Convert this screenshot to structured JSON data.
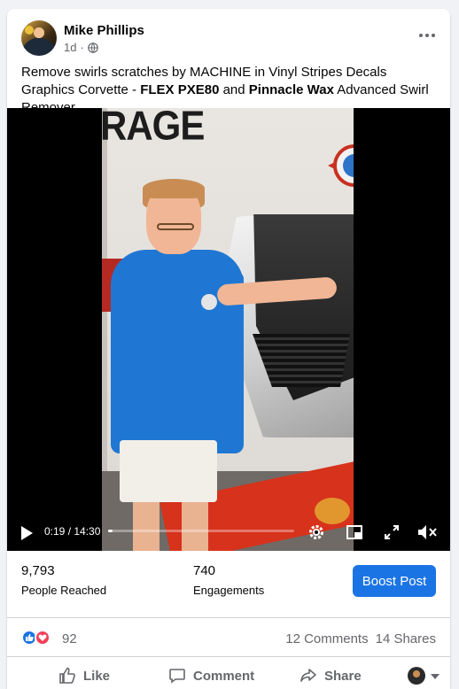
{
  "post": {
    "author": "Mike Phillips",
    "time": "1d",
    "time_sep": "·",
    "privacy_icon": "globe-icon",
    "text_parts": [
      {
        "t": "Remove swirls scratches by MACHINE in Vinyl Stripes Decals Graphics Corvette - ",
        "b": false
      },
      {
        "t": "FLEX PXE80",
        "b": true
      },
      {
        "t": " and ",
        "b": false
      },
      {
        "t": "Pinnacle Wax",
        "b": true
      },
      {
        "t": " Advanced Swirl Remover.",
        "b": false
      }
    ]
  },
  "video": {
    "wall_sign": "RAGE",
    "current_time": "0:19",
    "duration": "14:30",
    "time_display": "0:19 / 14:30",
    "progress": 0.022,
    "controls": [
      "play-icon",
      "settings-icon",
      "picture-in-picture-icon",
      "fullscreen-icon",
      "volume-muted-icon"
    ]
  },
  "stats": {
    "reached_value": "9,793",
    "reached_label": "People Reached",
    "engagements_value": "740",
    "engagements_label": "Engagements",
    "boost_label": "Boost Post"
  },
  "reactions": {
    "count": "92",
    "comments": "12 Comments",
    "shares": "14 Shares",
    "colors": {
      "like": "#1b74e4",
      "love": "#f33e58"
    }
  },
  "actions": {
    "like": "Like",
    "comment": "Comment",
    "share": "Share"
  },
  "colors": {
    "accent": "#1b74e4",
    "secondary_text": "#65676b",
    "background": "#f0f2f5"
  }
}
